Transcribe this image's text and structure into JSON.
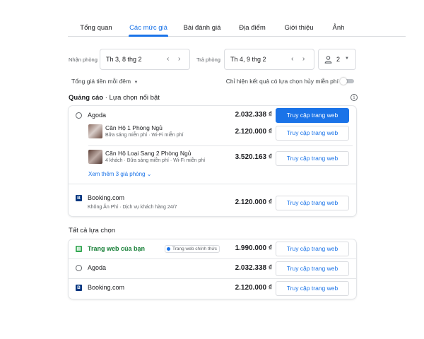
{
  "tabs": [
    "Tổng quan",
    "Các mức giá",
    "Bài đánh giá",
    "Địa điểm",
    "Giới thiệu",
    "Ảnh"
  ],
  "active_tab": "Các mức giá",
  "dates": {
    "checkin_label": "Nhận phòng",
    "checkin_value": "Th 3, 8 thg 2",
    "checkout_label": "Trả phòng",
    "checkout_value": "Th 4, 9 thg 2"
  },
  "guests": {
    "count": "2"
  },
  "filters": {
    "price_mode": "Tổng giá tiền mỗi đêm",
    "free_cancel_label": "Chỉ hiện kết quả có lựa chọn hủy miễn phí",
    "free_cancel_on": false
  },
  "featured": {
    "title_bold": "Quảng cáo",
    "title_rest": " · Lựa chọn nổi bật",
    "agoda": {
      "name": "Agoda",
      "price": "2.032.338 ₫",
      "button": "Truy cập trang web",
      "rooms": [
        {
          "name": "Căn Hộ 1 Phòng Ngủ",
          "details": "Bữa sáng miễn phí · Wi-Fi miễn phí",
          "price": "2.120.000 ₫",
          "button": "Truy cập trang web"
        },
        {
          "name": "Căn Hộ Loại Sang 2 Phòng Ngủ",
          "details": "4 khách · Bữa sáng miễn phí · Wi-Fi miễn phí",
          "price": "3.520.163 ₫",
          "button": "Truy cập trang web"
        }
      ],
      "more_rooms": "Xem thêm 3 giá phòng"
    },
    "booking": {
      "name": "Booking.com",
      "details": "Không Ăn Phí · Dịch vụ khách hàng 24/7",
      "price": "2.120.000 ₫",
      "button": "Truy cập trang web"
    }
  },
  "all_options": {
    "title": "Tất cả lựa chọn",
    "rows": [
      {
        "name": "Trang web của bạn",
        "badge": "Trang web chính thức",
        "price": "1.990.000 ₫",
        "button": "Truy cập trang web"
      },
      {
        "name": "Agoda",
        "price": "2.032.338 ₫",
        "button": "Truy cập trang web"
      },
      {
        "name": "Booking.com",
        "price": "2.120.000 ₫",
        "button": "Truy cập trang web"
      }
    ]
  },
  "colors": {
    "accent": "#1a73e8",
    "own_site": "#188038",
    "booking": "#003580"
  }
}
